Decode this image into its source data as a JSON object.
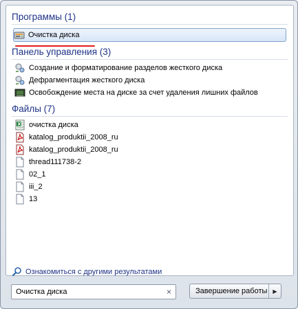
{
  "groups": {
    "programs": {
      "header": "Программы (1)",
      "items": [
        {
          "label": "Очистка диска",
          "icon": "disk-cleanup-icon"
        }
      ]
    },
    "control_panel": {
      "header": "Панель управления (3)",
      "items": [
        {
          "label": "Создание и форматирование разделов жесткого диска",
          "icon": "control-panel-tool-icon"
        },
        {
          "label": "Дефрагментация жесткого диска",
          "icon": "control-panel-tool-icon"
        },
        {
          "label": "Освобождение места на диске за счет удаления лишних файлов",
          "icon": "disk-cleanup-icon"
        }
      ]
    },
    "files": {
      "header": "Файлы (7)",
      "items": [
        {
          "label": "очистка диска",
          "icon": "excel-document-icon"
        },
        {
          "label": "katalog_produktii_2008_ru",
          "icon": "pdf-document-icon"
        },
        {
          "label": "katalog_produktii_2008_ru",
          "icon": "pdf-document-icon"
        },
        {
          "label": "thread111738-2",
          "icon": "blank-document-icon"
        },
        {
          "label": "02_1",
          "icon": "blank-document-icon"
        },
        {
          "label": "iii_2",
          "icon": "blank-document-icon"
        },
        {
          "label": "13",
          "icon": "blank-document-icon"
        }
      ]
    }
  },
  "more_results": {
    "label": "Ознакомиться с другими результатами",
    "icon": "search-icon"
  },
  "search": {
    "value": "Очистка диска",
    "clear": "×"
  },
  "shutdown": {
    "label": "Завершение работы",
    "arrow": "▶"
  },
  "colors": {
    "header": "#1e3287",
    "highlight_underline": "#e11b1b",
    "selection_border": "#7da2ce"
  }
}
